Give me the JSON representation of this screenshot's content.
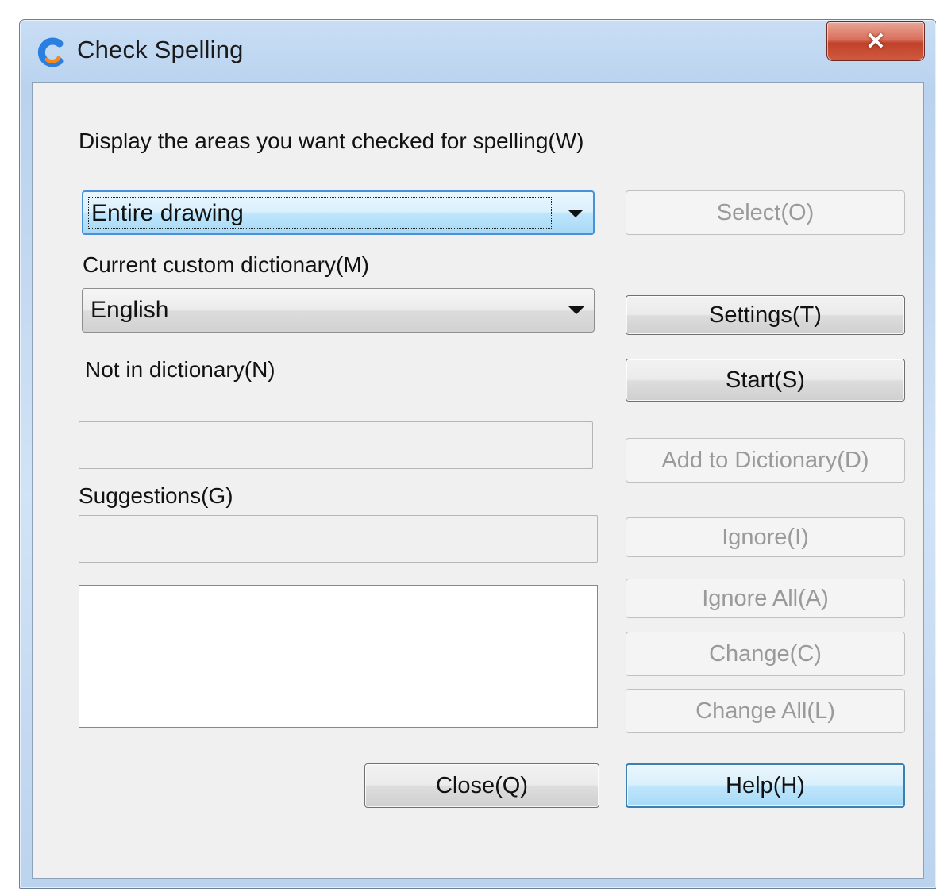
{
  "window": {
    "title": "Check Spelling",
    "close_symbol": "✕"
  },
  "areas": {
    "label": "Display the areas you want checked for spelling(W)",
    "selected": "Entire drawing"
  },
  "dictionary": {
    "label": "Current custom dictionary(M)",
    "selected": "English"
  },
  "not_in_dictionary": {
    "label": "Not in dictionary(N)",
    "value": ""
  },
  "suggestions": {
    "label": "Suggestions(G)",
    "value": ""
  },
  "buttons": {
    "select": "Select(O)",
    "settings": "Settings(T)",
    "start": "Start(S)",
    "add_to_dictionary": "Add to Dictionary(D)",
    "ignore": "Ignore(I)",
    "ignore_all": "Ignore All(A)",
    "change": "Change(C)",
    "change_all": "Change All(L)",
    "close": "Close(Q)",
    "help": "Help(H)"
  },
  "icons": {
    "app": "app-logo-icon",
    "close": "close-icon",
    "dropdown": "chevron-down-icon"
  },
  "colors": {
    "accent": "#4a90d8",
    "close_button": "#c94a33",
    "disabled_text": "#9a9a9a"
  }
}
